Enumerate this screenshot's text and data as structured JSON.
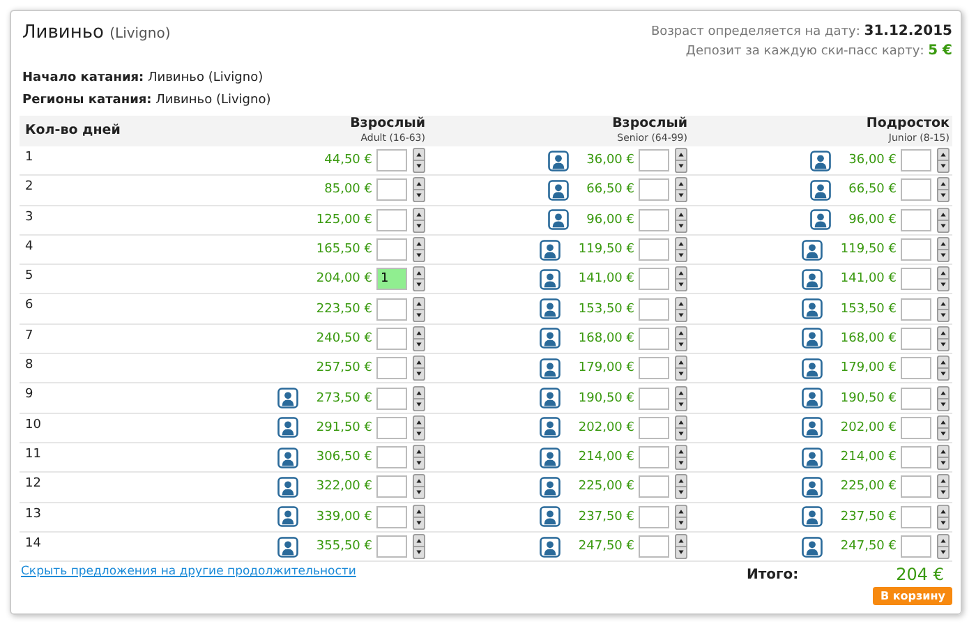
{
  "title": {
    "name": "Ливиньо",
    "sub": "(Livigno)"
  },
  "age_note": {
    "label": "Возраст определяется на дату:",
    "value": "31.12.2015"
  },
  "deposit_note": {
    "label": "Депозит за каждую ски-пасс карту:",
    "value": "5 €"
  },
  "info": [
    {
      "label": "Начало катания:",
      "value": "Ливиньо (Livigno)"
    },
    {
      "label": "Регионы катания:",
      "value": "Ливиньо (Livigno)"
    }
  ],
  "columns": [
    {
      "label": "Кол-во дней"
    },
    {
      "label": "Взрослый",
      "sub": "Adult (16-63)"
    },
    {
      "label": "Взрослый",
      "sub": "Senior (64-99)"
    },
    {
      "label": "Подросток",
      "sub": "Junior (8-15)"
    }
  ],
  "rows": [
    {
      "days": "1",
      "cells": [
        {
          "price": "44,50 €",
          "photo": false
        },
        {
          "price": "36,00 €",
          "photo": true
        },
        {
          "price": "36,00 €",
          "photo": true
        }
      ]
    },
    {
      "days": "2",
      "cells": [
        {
          "price": "85,00 €",
          "photo": false
        },
        {
          "price": "66,50 €",
          "photo": true
        },
        {
          "price": "66,50 €",
          "photo": true
        }
      ]
    },
    {
      "days": "3",
      "cells": [
        {
          "price": "125,00 €",
          "photo": false
        },
        {
          "price": "96,00 €",
          "photo": true
        },
        {
          "price": "96,00 €",
          "photo": true
        }
      ]
    },
    {
      "days": "4",
      "cells": [
        {
          "price": "165,50 €",
          "photo": false
        },
        {
          "price": "119,50 €",
          "photo": true
        },
        {
          "price": "119,50 €",
          "photo": true
        }
      ]
    },
    {
      "days": "5",
      "cells": [
        {
          "price": "204,00 €",
          "photo": false,
          "value": "1"
        },
        {
          "price": "141,00 €",
          "photo": true
        },
        {
          "price": "141,00 €",
          "photo": true
        }
      ]
    },
    {
      "days": "6",
      "cells": [
        {
          "price": "223,50 €",
          "photo": false
        },
        {
          "price": "153,50 €",
          "photo": true
        },
        {
          "price": "153,50 €",
          "photo": true
        }
      ]
    },
    {
      "days": "7",
      "cells": [
        {
          "price": "240,50 €",
          "photo": false
        },
        {
          "price": "168,00 €",
          "photo": true
        },
        {
          "price": "168,00 €",
          "photo": true
        }
      ]
    },
    {
      "days": "8",
      "cells": [
        {
          "price": "257,50 €",
          "photo": false
        },
        {
          "price": "179,00 €",
          "photo": true
        },
        {
          "price": "179,00 €",
          "photo": true
        }
      ]
    },
    {
      "days": "9",
      "cells": [
        {
          "price": "273,50 €",
          "photo": true
        },
        {
          "price": "190,50 €",
          "photo": true
        },
        {
          "price": "190,50 €",
          "photo": true
        }
      ]
    },
    {
      "days": "10",
      "cells": [
        {
          "price": "291,50 €",
          "photo": true
        },
        {
          "price": "202,00 €",
          "photo": true
        },
        {
          "price": "202,00 €",
          "photo": true
        }
      ]
    },
    {
      "days": "11",
      "cells": [
        {
          "price": "306,50 €",
          "photo": true
        },
        {
          "price": "214,00 €",
          "photo": true
        },
        {
          "price": "214,00 €",
          "photo": true
        }
      ]
    },
    {
      "days": "12",
      "cells": [
        {
          "price": "322,00 €",
          "photo": true
        },
        {
          "price": "225,00 €",
          "photo": true
        },
        {
          "price": "225,00 €",
          "photo": true
        }
      ]
    },
    {
      "days": "13",
      "cells": [
        {
          "price": "339,00 €",
          "photo": true
        },
        {
          "price": "237,50 €",
          "photo": true
        },
        {
          "price": "237,50 €",
          "photo": true
        }
      ]
    },
    {
      "days": "14",
      "cells": [
        {
          "price": "355,50 €",
          "photo": true
        },
        {
          "price": "247,50 €",
          "photo": true
        },
        {
          "price": "247,50 €",
          "photo": true
        }
      ]
    }
  ],
  "hide_link": "Скрыть предложения на другие продолжительности",
  "total": {
    "label": "Итого:",
    "value": "204 €"
  },
  "cart_button": "В корзину"
}
